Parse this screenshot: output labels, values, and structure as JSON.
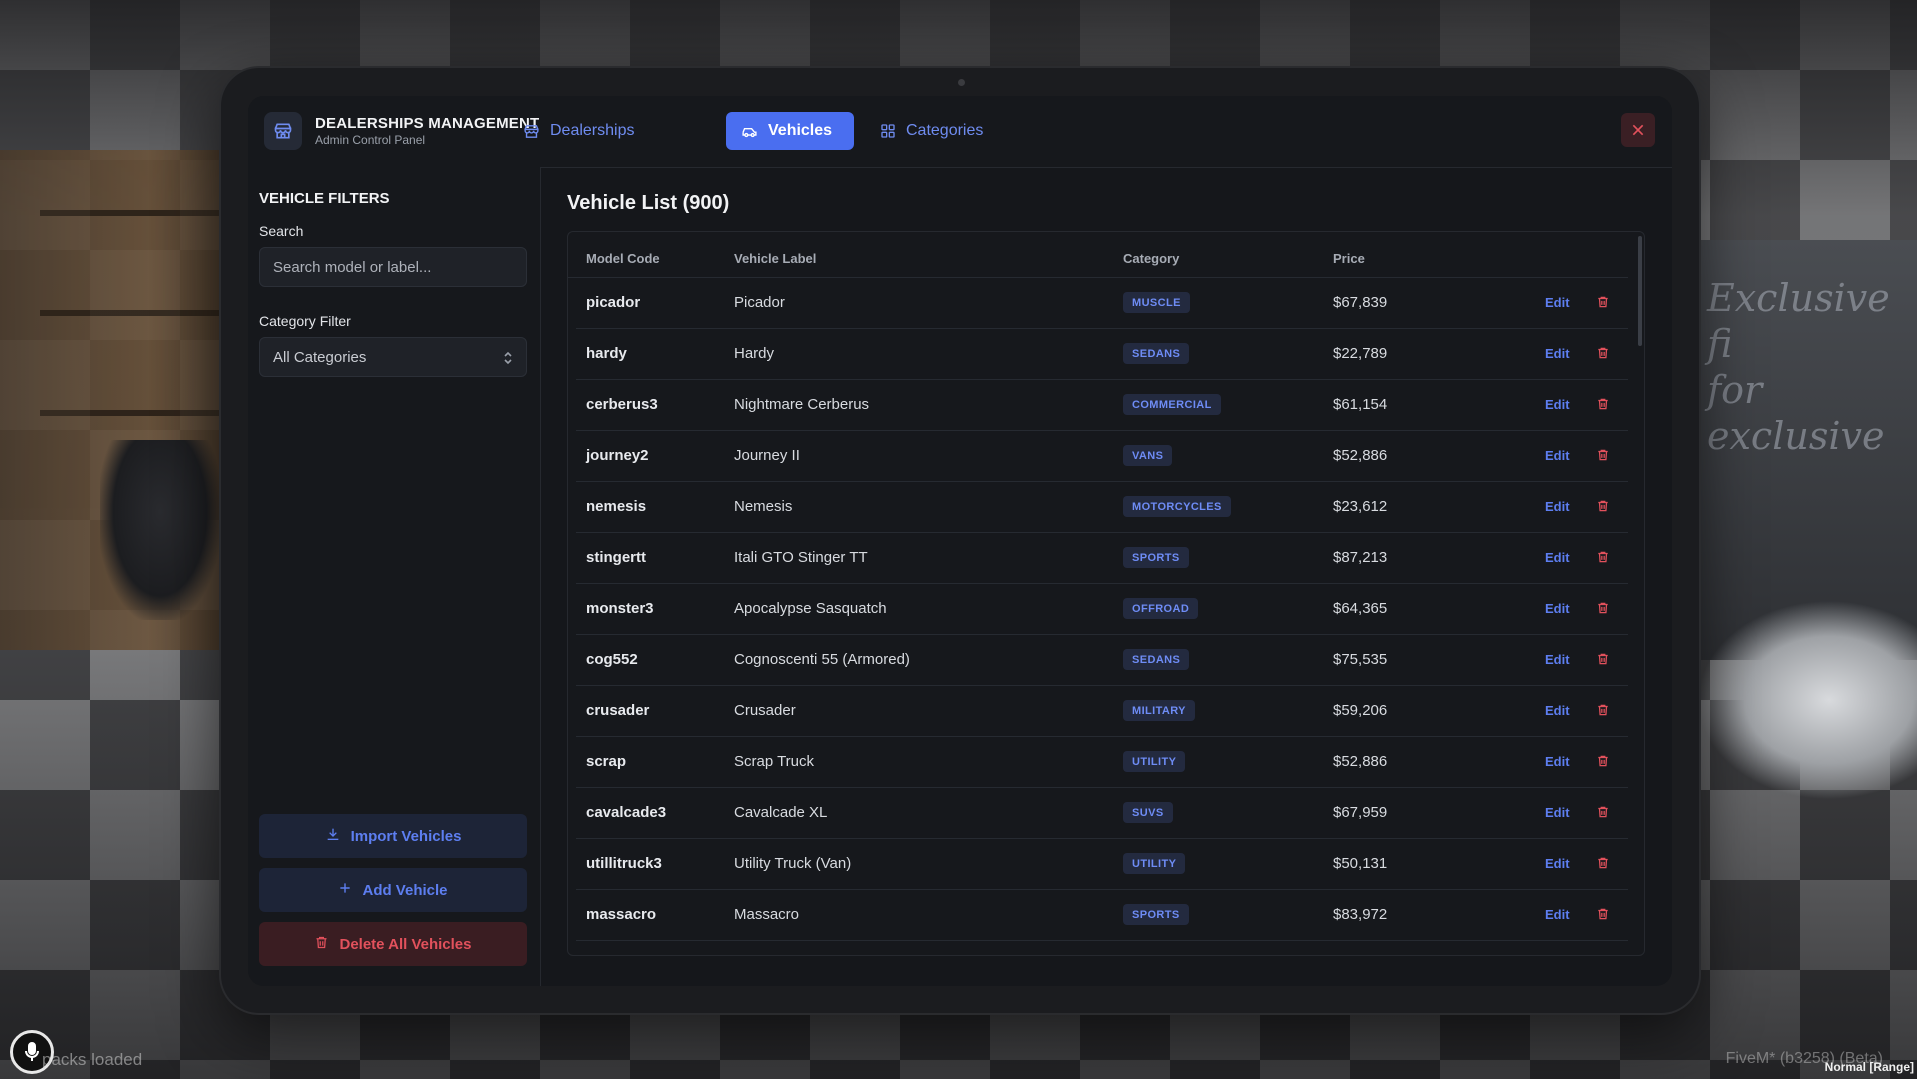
{
  "app": {
    "title": "DEALERSHIPS MANAGEMENT",
    "subtitle": "Admin Control Panel"
  },
  "tabs": [
    {
      "label": "Dealerships",
      "icon": "store-icon",
      "active": false
    },
    {
      "label": "Vehicles",
      "icon": "car-icon",
      "active": true
    },
    {
      "label": "Categories",
      "icon": "grid-icon",
      "active": false
    }
  ],
  "sidebar": {
    "title": "VEHICLE FILTERS",
    "search_label": "Search",
    "search_placeholder": "Search model or label...",
    "category_label": "Category Filter",
    "category_selected": "All Categories",
    "import_label": "Import Vehicles",
    "add_label": "Add Vehicle",
    "delete_all_label": "Delete All Vehicles"
  },
  "main": {
    "list_title": "Vehicle List (900)",
    "columns": [
      "Model Code",
      "Vehicle Label",
      "Category",
      "Price"
    ],
    "edit_label": "Edit",
    "rows": [
      {
        "code": "picador",
        "label": "Picador",
        "category": "MUSCLE",
        "price": "$67,839"
      },
      {
        "code": "hardy",
        "label": "Hardy",
        "category": "SEDANS",
        "price": "$22,789"
      },
      {
        "code": "cerberus3",
        "label": "Nightmare Cerberus",
        "category": "COMMERCIAL",
        "price": "$61,154"
      },
      {
        "code": "journey2",
        "label": "Journey II",
        "category": "VANS",
        "price": "$52,886"
      },
      {
        "code": "nemesis",
        "label": "Nemesis",
        "category": "MOTORCYCLES",
        "price": "$23,612"
      },
      {
        "code": "stingertt",
        "label": "Itali GTO Stinger TT",
        "category": "SPORTS",
        "price": "$87,213"
      },
      {
        "code": "monster3",
        "label": "Apocalypse Sasquatch",
        "category": "OFFROAD",
        "price": "$64,365"
      },
      {
        "code": "cog552",
        "label": "Cognoscenti 55 (Armored)",
        "category": "SEDANS",
        "price": "$75,535"
      },
      {
        "code": "crusader",
        "label": "Crusader",
        "category": "MILITARY",
        "price": "$59,206"
      },
      {
        "code": "scrap",
        "label": "Scrap Truck",
        "category": "UTILITY",
        "price": "$52,886"
      },
      {
        "code": "cavalcade3",
        "label": "Cavalcade XL",
        "category": "SUVS",
        "price": "$67,959"
      },
      {
        "code": "utillitruck3",
        "label": "Utility Truck (Van)",
        "category": "UTILITY",
        "price": "$50,131"
      },
      {
        "code": "massacro",
        "label": "Massacro",
        "category": "SPORTS",
        "price": "$83,972"
      }
    ]
  },
  "background": {
    "poster_line1": "Exclusive fi",
    "poster_line2": "for exclusive"
  },
  "overlay": {
    "status_left": "packs loaded",
    "status_right": "FiveM* (b3258) (Beta)",
    "status_right2": "Normal [Range]"
  },
  "colors": {
    "accent": "#4a6ef0",
    "danger": "#e2515c",
    "panel": "#15171b"
  }
}
